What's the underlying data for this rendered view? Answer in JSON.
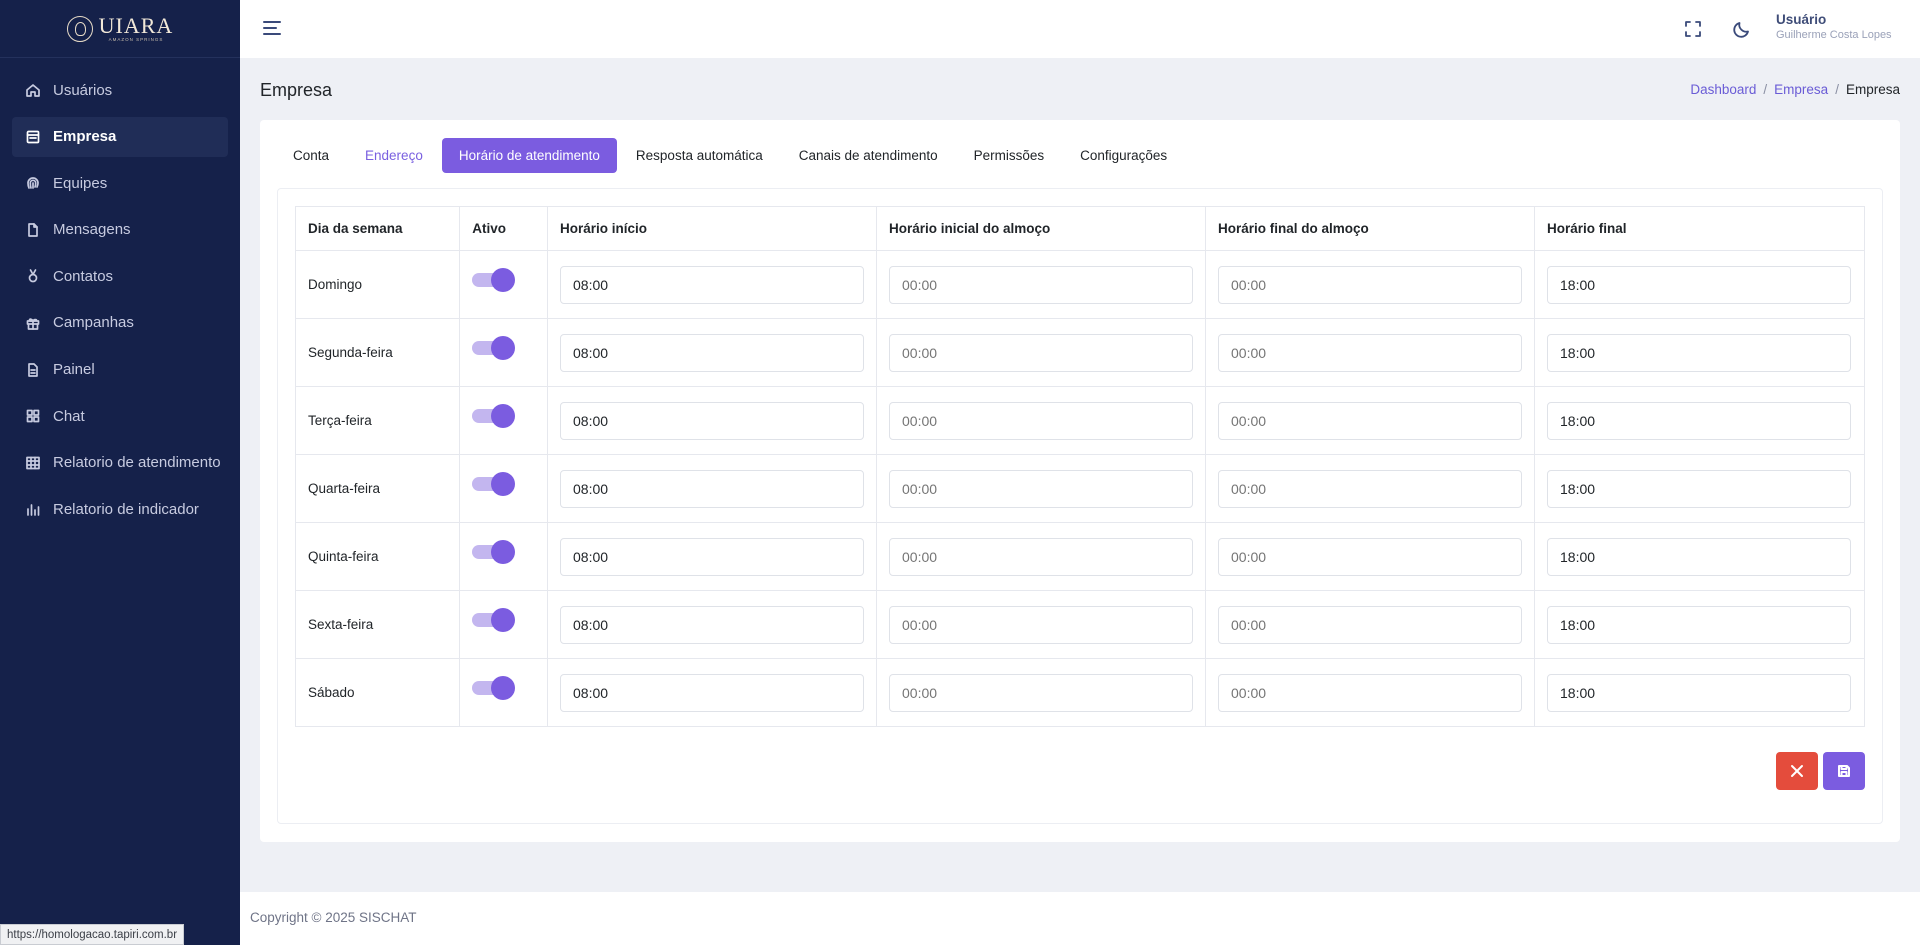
{
  "brand": {
    "name": "UIARA",
    "tagline": "AMAZON SPRINGS"
  },
  "sidebar": {
    "items": [
      {
        "label": "Usuários",
        "icon": "home-icon",
        "active": false
      },
      {
        "label": "Empresa",
        "icon": "building-icon",
        "active": true
      },
      {
        "label": "Equipes",
        "icon": "fingerprint-icon",
        "active": false
      },
      {
        "label": "Mensagens",
        "icon": "file-icon",
        "active": false
      },
      {
        "label": "Contatos",
        "icon": "medal-icon",
        "active": false
      },
      {
        "label": "Campanhas",
        "icon": "gift-icon",
        "active": false
      },
      {
        "label": "Painel",
        "icon": "document-icon",
        "active": false
      },
      {
        "label": "Chat",
        "icon": "grid-icon",
        "active": false
      },
      {
        "label": "Relatorio de atendimento",
        "icon": "table-icon",
        "active": false
      },
      {
        "label": "Relatorio de indicador",
        "icon": "bar-chart-icon",
        "active": false
      }
    ]
  },
  "topbar": {
    "user_title": "Usuário",
    "user_name": "Guilherme Costa Lopes"
  },
  "page": {
    "title": "Empresa",
    "breadcrumb": [
      "Dashboard",
      "Empresa",
      "Empresa"
    ]
  },
  "tabs": [
    {
      "label": "Conta",
      "state": "normal"
    },
    {
      "label": "Endereço",
      "state": "link"
    },
    {
      "label": "Horário de atendimento",
      "state": "active"
    },
    {
      "label": "Resposta automática",
      "state": "normal"
    },
    {
      "label": "Canais de atendimento",
      "state": "normal"
    },
    {
      "label": "Permissões",
      "state": "normal"
    },
    {
      "label": "Configurações",
      "state": "normal"
    }
  ],
  "schedule": {
    "headers": [
      "Dia da semana",
      "Ativo",
      "Horário início",
      "Horário inicial do almoço",
      "Horário final do almoço",
      "Horário final"
    ],
    "lunch_placeholder": "00:00",
    "rows": [
      {
        "day": "Domingo",
        "active": true,
        "start": "08:00",
        "lunch_start": "",
        "lunch_end": "",
        "end": "18:00"
      },
      {
        "day": "Segunda-feira",
        "active": true,
        "start": "08:00",
        "lunch_start": "",
        "lunch_end": "",
        "end": "18:00"
      },
      {
        "day": "Terça-feira",
        "active": true,
        "start": "08:00",
        "lunch_start": "",
        "lunch_end": "",
        "end": "18:00"
      },
      {
        "day": "Quarta-feira",
        "active": true,
        "start": "08:00",
        "lunch_start": "",
        "lunch_end": "",
        "end": "18:00"
      },
      {
        "day": "Quinta-feira",
        "active": true,
        "start": "08:00",
        "lunch_start": "",
        "lunch_end": "",
        "end": "18:00"
      },
      {
        "day": "Sexta-feira",
        "active": true,
        "start": "08:00",
        "lunch_start": "",
        "lunch_end": "",
        "end": "18:00"
      },
      {
        "day": "Sábado",
        "active": true,
        "start": "08:00",
        "lunch_start": "",
        "lunch_end": "",
        "end": "18:00"
      }
    ]
  },
  "actions": {
    "cancel_icon": "close-icon",
    "save_icon": "save-icon"
  },
  "footer": {
    "text": "Copyright © 2025 SISCHAT"
  },
  "status_bar": {
    "url": "https://homologacao.tapiri.com.br"
  },
  "colors": {
    "sidebar": "#15214a",
    "accent": "#7b5ce0",
    "danger": "#e44c3c"
  }
}
